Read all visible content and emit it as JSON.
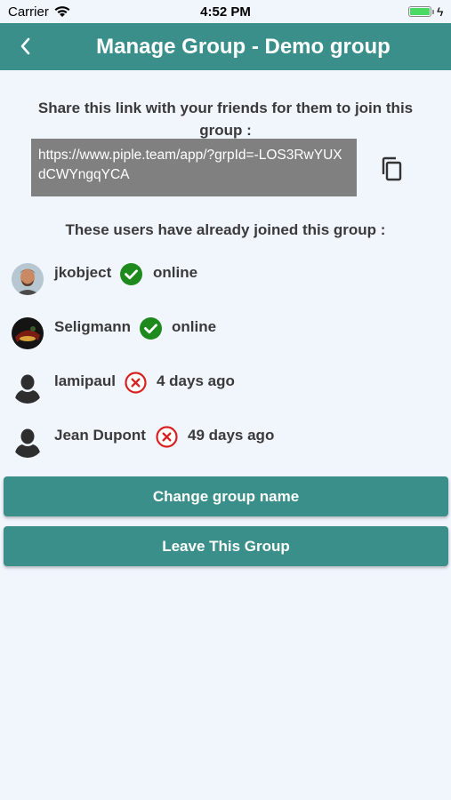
{
  "status_bar": {
    "carrier": "Carrier",
    "time": "4:52 PM",
    "battery_level": 1.0,
    "charging_icon": "bolt-icon"
  },
  "header": {
    "title": "Manage Group - Demo group",
    "back_icon": "chevron-left-icon",
    "background_color": "#3a8f8a"
  },
  "share": {
    "instruction": "Share this link with your friends for them to join this group :",
    "link": "https://www.piple.team/app/?grpId=-LOS3RwYUXdCWYngqYCA",
    "copy_icon": "copy-icon"
  },
  "members": {
    "heading": "These users have already joined this group :",
    "users": [
      {
        "name": "jkobject",
        "status": "online",
        "online": true,
        "avatar": "photo"
      },
      {
        "name": "Seligmann",
        "status": "online",
        "online": true,
        "avatar": "photo"
      },
      {
        "name": "lamipaul",
        "status": "4 days ago",
        "online": false,
        "avatar": "default"
      },
      {
        "name": "Jean Dupont",
        "status": "49 days ago",
        "online": false,
        "avatar": "default"
      }
    ]
  },
  "actions": {
    "change_name_label": "Change group name",
    "leave_label": "Leave This Group"
  },
  "colors": {
    "online": "#1e8a1e",
    "offline": "#d92020",
    "accent": "#3a8f8a"
  }
}
